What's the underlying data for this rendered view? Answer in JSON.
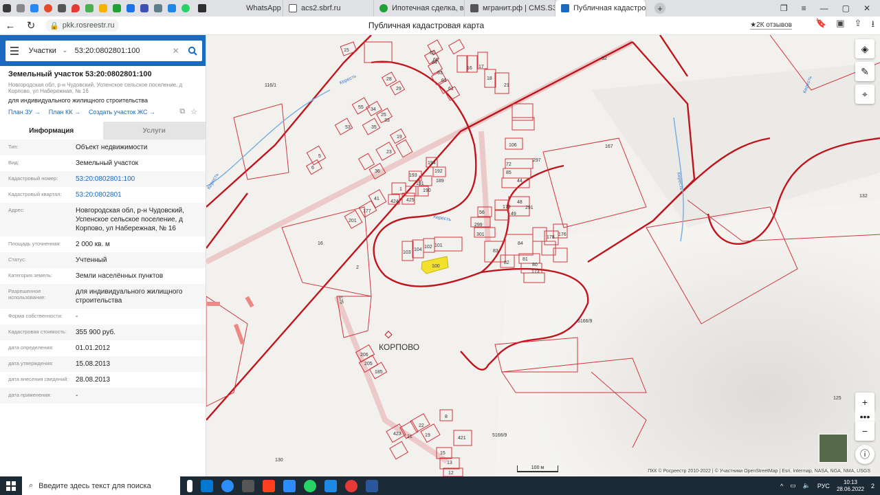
{
  "browser": {
    "tabs": [
      {
        "label": "WhatsApp",
        "icon": "whatsapp-icon",
        "color": "#2e2e2e"
      },
      {
        "label": "acs2.sbrf.ru",
        "icon": "page-icon",
        "color": "#ffffff"
      },
      {
        "label": "Ипотечная сделка, войти",
        "icon": "green-icon",
        "color": "#21a038"
      },
      {
        "label": "мгранит.рф | CMS.S3",
        "icon": "cms-icon",
        "color": "#555555"
      },
      {
        "label": "Публичная кадастрова",
        "icon": "rosreestr-icon",
        "color": "#1a6ac0",
        "active": true
      }
    ],
    "url": "pkk.rosreestr.ru",
    "page_title": "Публичная кадастровая карта",
    "reviews": "★2К отзывов"
  },
  "search": {
    "type": "Участки",
    "value": "53:20:0802801:100"
  },
  "object": {
    "title": "Земельный участок 53:20:0802801:100",
    "address": "Новгородская обл, р-н Чудовский, Успенское сельское поселение, д Корпово, ул Набережная, № 16",
    "use": "для индивидуального жилищного строительства",
    "links": [
      "План ЗУ →",
      "План КК →",
      "Создать участок ЖС →"
    ]
  },
  "panel_tabs": [
    "Информация",
    "Услуги"
  ],
  "info_rows": [
    {
      "k": "Тип:",
      "v": "Объект недвижимости"
    },
    {
      "k": "Вид:",
      "v": "Земельный участок"
    },
    {
      "k": "Кадастровый номер:",
      "v": "53:20:0802801:100",
      "link": true
    },
    {
      "k": "Кадастровый квартал:",
      "v": "53:20:0802801",
      "link": true
    },
    {
      "k": "Адрес:",
      "v": "Новгородская обл, р-н Чудовский, Успенское сельское поселение, д Корпово, ул Набережная, № 16"
    },
    {
      "k": "Площадь уточненная:",
      "v": "2 000 кв. м"
    },
    {
      "k": "Статус:",
      "v": "Учтенный"
    },
    {
      "k": "Категория земель:",
      "v": "Земли населённых пунктов"
    },
    {
      "k": "Разрешенное использование:",
      "v": "для индивидуального жилищного строительства"
    },
    {
      "k": "Форма собственности:",
      "v": "-"
    },
    {
      "k": "Кадастровая стоимость:",
      "v": "355 900 руб."
    },
    {
      "k": "дата определения:",
      "v": "01.01.2012"
    },
    {
      "k": "дата утверждения:",
      "v": "15.08.2013"
    },
    {
      "k": "дата внесения сведений:",
      "v": "28.08.2013"
    },
    {
      "k": "дата применения:",
      "v": "-"
    }
  ],
  "map": {
    "village": "КОРПОВО",
    "river": "Кересть",
    "parcel_labels": [
      "15",
      "116/1",
      "28",
      "29",
      "55",
      "34",
      "25",
      "33",
      "53",
      "35",
      "19",
      "23",
      "5",
      "6",
      "36",
      "194",
      "193",
      "192",
      "189",
      "191",
      "190",
      "1",
      "424",
      "425",
      "41",
      "177",
      "201",
      "16",
      "2",
      "103",
      "104",
      "102",
      "101",
      "100",
      "301",
      "299",
      "56",
      "83",
      "84",
      "82",
      "81",
      "80",
      "173",
      "178",
      "176",
      "72",
      "85",
      "44",
      "48",
      "291",
      "49",
      "179",
      "106",
      "167",
      "92",
      "21",
      "18",
      "17",
      "16",
      "61",
      "62",
      "63",
      "64",
      "65",
      "66",
      "297",
      "132",
      "5166/9",
      "206",
      "205",
      "185",
      "8",
      "423",
      "22",
      "21",
      "19",
      "421",
      "15",
      "13",
      "12",
      "125",
      "130",
      "575",
      "5166/9"
    ],
    "scale": "100 м",
    "attribution": "ПКК © Росреестр 2010-2022 | © Участники OpenStreetMap | Esri, Intermap, NASA, NGA, NMA, USGS",
    "colors": {
      "boundary": "#c0141c",
      "parcel": "#d0343c",
      "selected": "#f2e22e"
    }
  },
  "taskbar": {
    "search_placeholder": "Введите здесь текст для поиска",
    "lang": "РУС",
    "time": "10:13",
    "date": "28.06.2022",
    "notifications": "2"
  }
}
